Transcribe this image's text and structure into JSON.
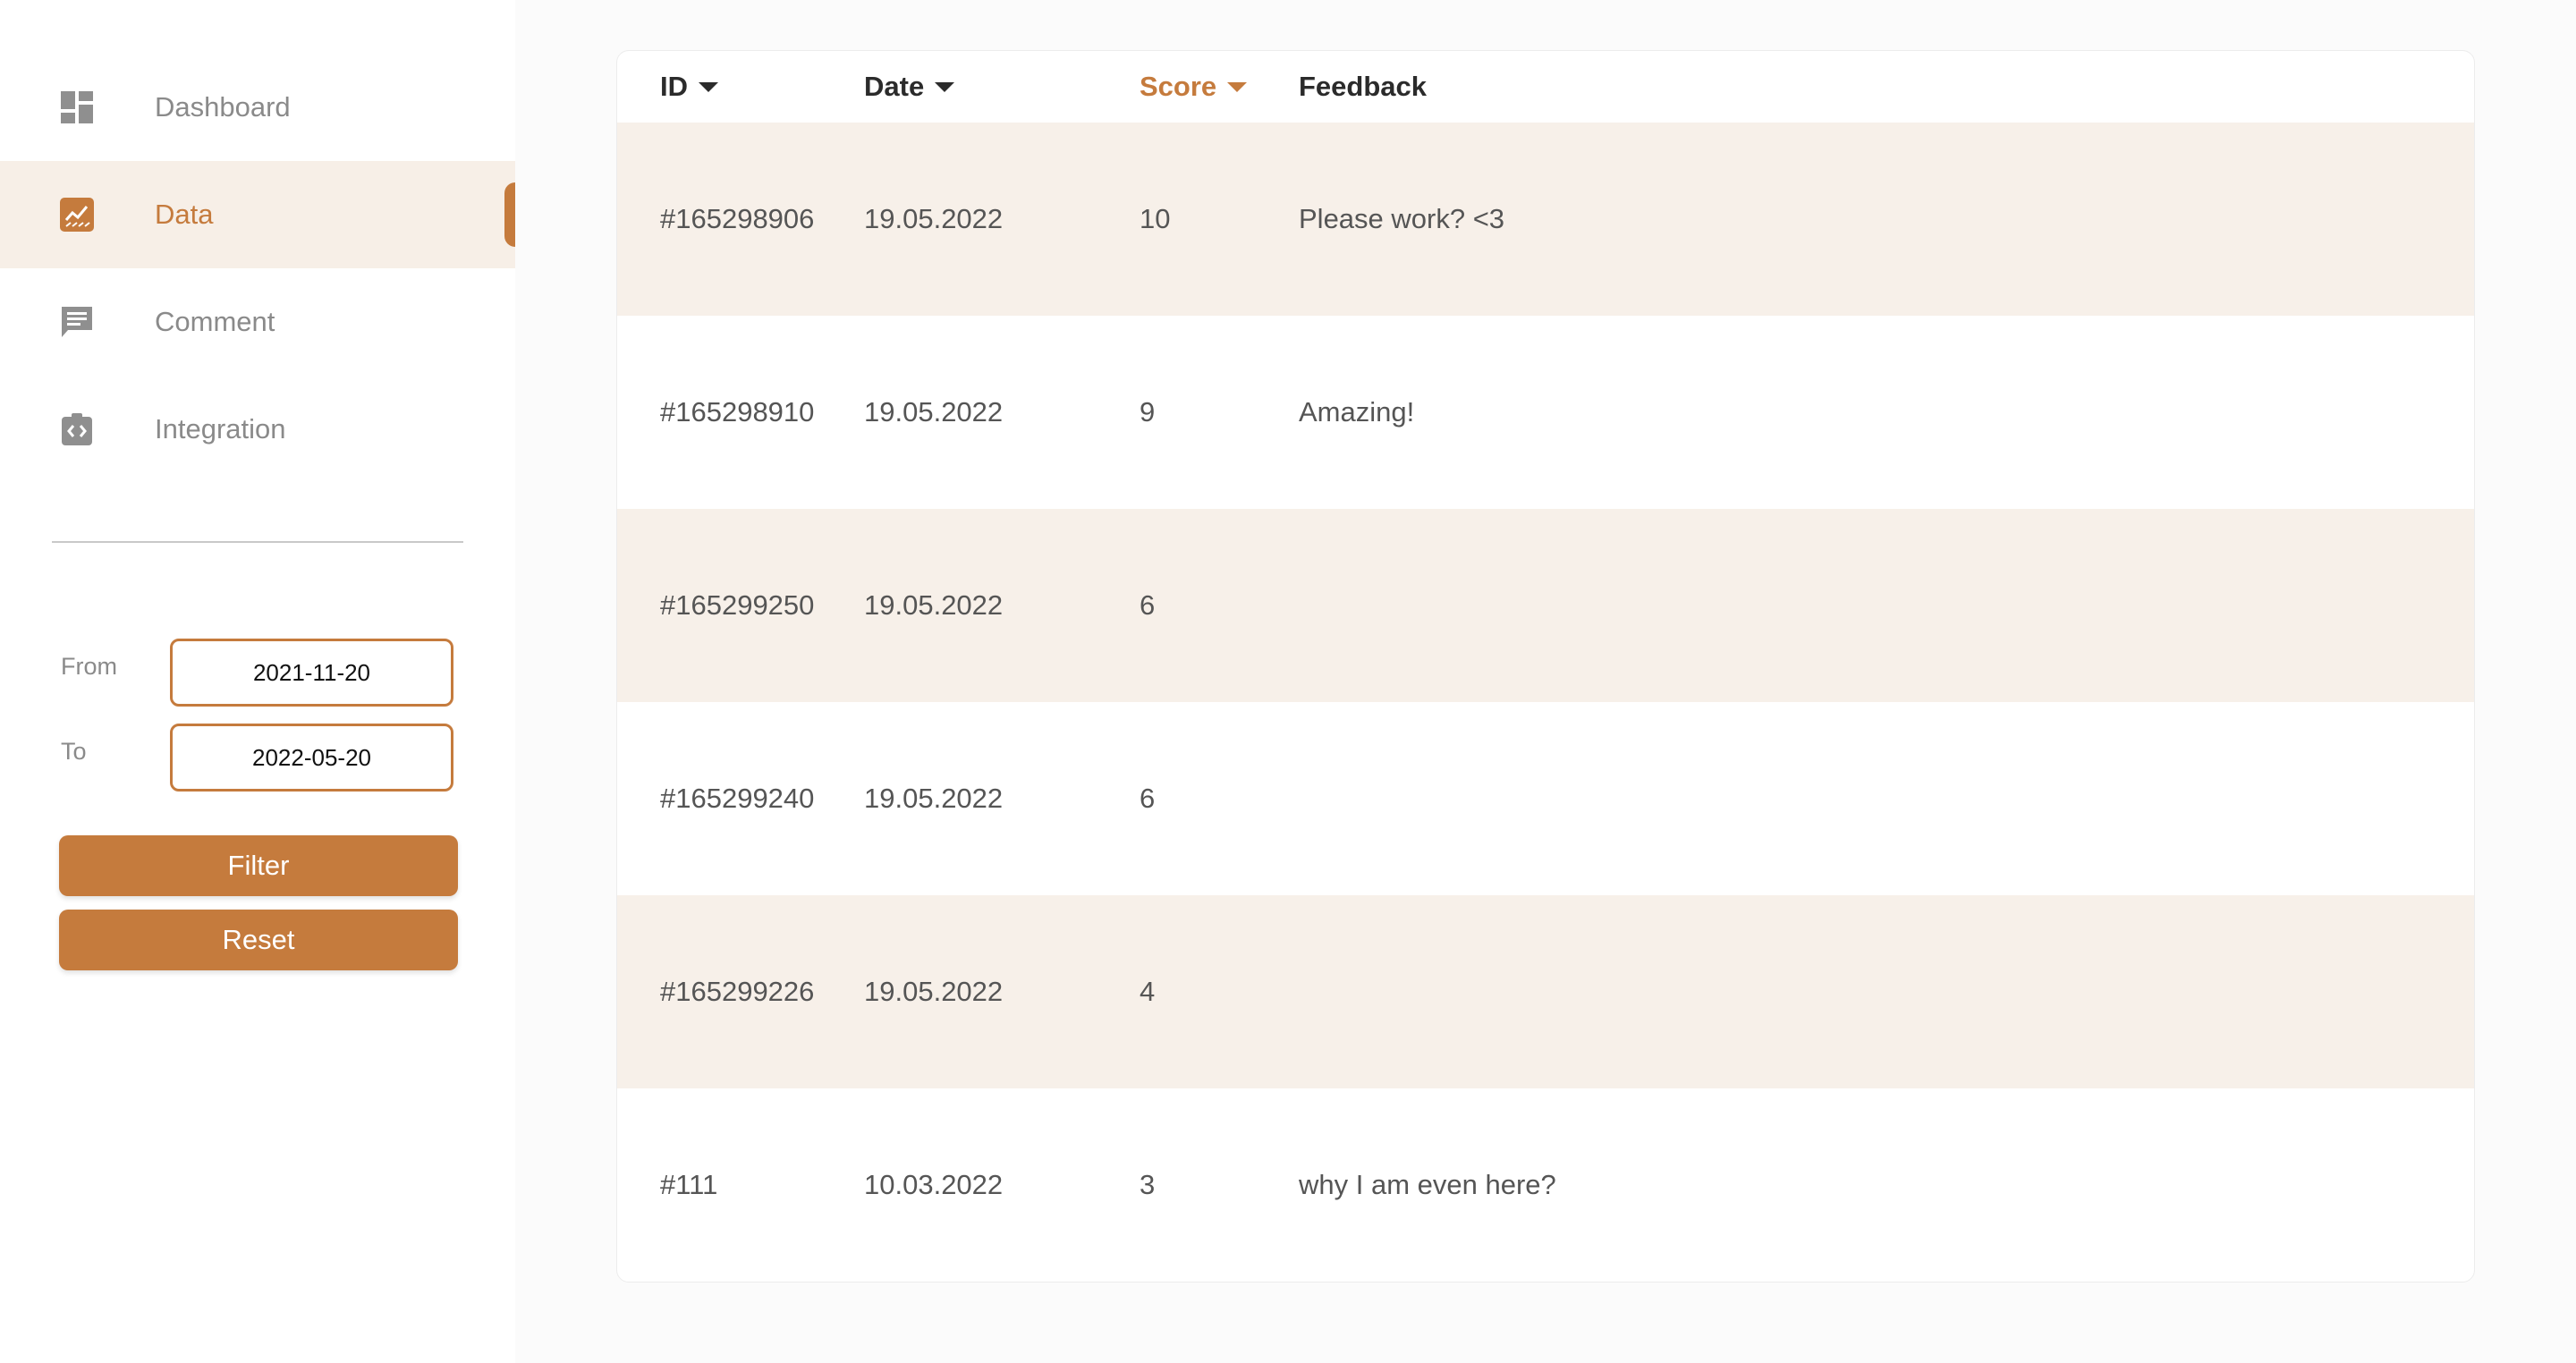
{
  "sidebar": {
    "items": [
      {
        "label": "Dashboard",
        "icon": "dashboard-icon"
      },
      {
        "label": "Data",
        "icon": "chart-icon",
        "active": true
      },
      {
        "label": "Comment",
        "icon": "comment-icon"
      },
      {
        "label": "Integration",
        "icon": "integration-icon"
      }
    ],
    "filter": {
      "from_label": "From",
      "from_value": "2021-11-20",
      "to_label": "To",
      "to_value": "2022-05-20",
      "filter_button": "Filter",
      "reset_button": "Reset"
    }
  },
  "table": {
    "columns": [
      {
        "label": "ID",
        "sortable": true
      },
      {
        "label": "Date",
        "sortable": true
      },
      {
        "label": "Score",
        "sortable": true,
        "sorted": true
      },
      {
        "label": "Feedback",
        "sortable": false
      }
    ],
    "rows": [
      {
        "id": "#165298906",
        "date": "19.05.2022",
        "score": "10",
        "feedback": "Please work? <3"
      },
      {
        "id": "#165298910",
        "date": "19.05.2022",
        "score": "9",
        "feedback": "Amazing!"
      },
      {
        "id": "#165299250",
        "date": "19.05.2022",
        "score": "6",
        "feedback": ""
      },
      {
        "id": "#165299240",
        "date": "19.05.2022",
        "score": "6",
        "feedback": ""
      },
      {
        "id": "#165299226",
        "date": "19.05.2022",
        "score": "4",
        "feedback": ""
      },
      {
        "id": "#111",
        "date": "10.03.2022",
        "score": "3",
        "feedback": "why I am even here?"
      }
    ]
  },
  "colors": {
    "accent": "#c57b3d",
    "row_alt": "#f7f0e9",
    "muted_text": "#8a8a8a"
  }
}
